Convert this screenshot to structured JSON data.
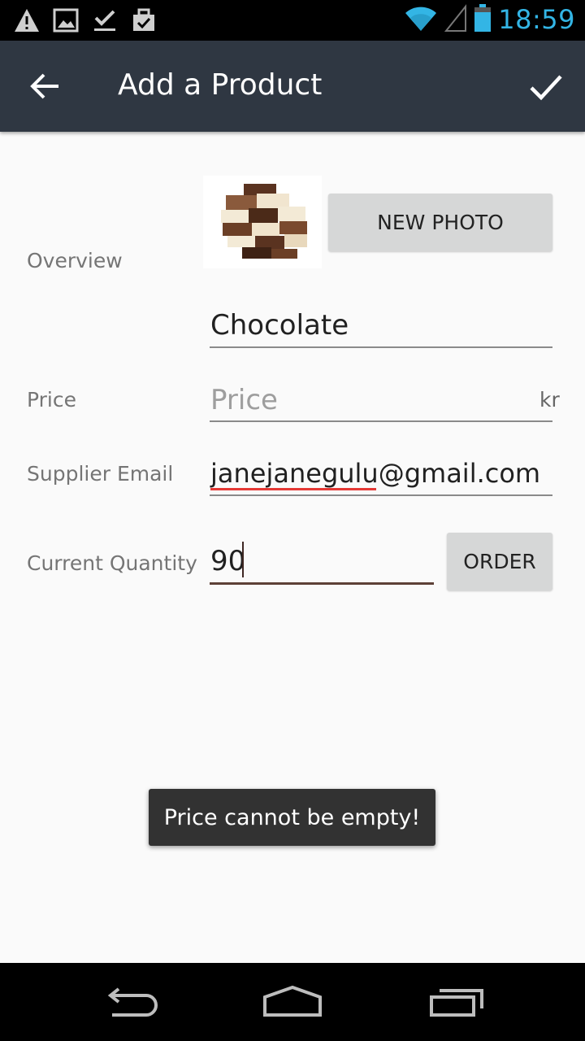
{
  "status_bar": {
    "time": "18:59",
    "icons": [
      "warning-icon",
      "image-icon",
      "download-done-icon",
      "bag-check-icon",
      "wifi-icon",
      "cell-signal-icon",
      "battery-icon"
    ]
  },
  "app_bar": {
    "title": "Add a Product",
    "back_icon": "arrow-back-icon",
    "confirm_icon": "check-icon"
  },
  "form": {
    "overview_label": "Overview",
    "new_photo_label": "NEW PHOTO",
    "product_name": "Chocolate",
    "price_label": "Price",
    "price_placeholder": "Price",
    "price_unit": "kr",
    "supplier_email_label": "Supplier Email",
    "supplier_email_value": "janejanegulu@gmail.com",
    "quantity_label": "Current Quantity",
    "quantity_value": "90",
    "order_label": "ORDER"
  },
  "toast": {
    "message": "Price cannot be empty!"
  },
  "nav_bar": {
    "icons": [
      "back-nav-icon",
      "home-nav-icon",
      "recents-nav-icon"
    ]
  },
  "colors": {
    "app_bar": "#2f3742",
    "status_accent": "#33b5e5",
    "active_underline": "#5d4037",
    "spellcheck_underline": "#e53935"
  }
}
